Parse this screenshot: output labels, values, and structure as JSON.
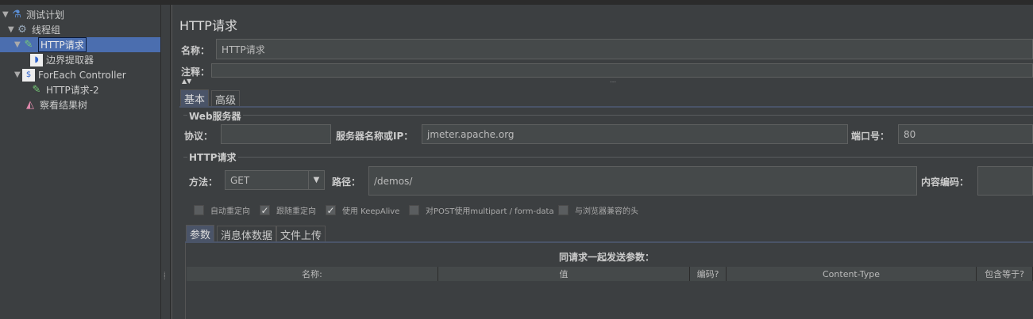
{
  "tree": [
    {
      "label": "测试计划",
      "icon": "test-plan-flask-icon"
    },
    {
      "label": "线程组",
      "icon": "thread-group-gear-icon"
    },
    {
      "label": "HTTP请求",
      "icon": "sampler-pipette-icon",
      "selected": true
    },
    {
      "label": "边界提取器",
      "icon": "extractor-icon"
    },
    {
      "label": "ForEach Controller",
      "icon": "controller-icon"
    },
    {
      "label": "HTTP请求-2",
      "icon": "sampler-pipette-icon"
    },
    {
      "label": "察看结果树",
      "icon": "listener-chart-icon"
    }
  ],
  "panel": {
    "title": "HTTP请求",
    "name_label": "名称：",
    "name_value": "HTTP请求",
    "comment_label": "注释：",
    "comment_value": "",
    "tabs": [
      "基本",
      "高级"
    ],
    "web_server": {
      "legend": "Web服务器",
      "protocol_label": "协议：",
      "protocol_value": "",
      "server_label": "服务器名称或IP：",
      "server_value": "jmeter.apache.org",
      "port_label": "端口号：",
      "port_value": "80"
    },
    "http": {
      "legend": "HTTP请求",
      "method_label": "方法：",
      "method_value": "GET",
      "path_label": "路径：",
      "path_value": "/demos/",
      "encoding_label": "内容编码：",
      "encoding_value": ""
    },
    "checkboxes": [
      {
        "label": "自动重定向",
        "checked": false
      },
      {
        "label": "跟随重定向",
        "checked": true
      },
      {
        "label": "使用 KeepAlive",
        "checked": true
      },
      {
        "label": "对POST使用multipart / form-data",
        "checked": false
      },
      {
        "label": "与浏览器兼容的头",
        "checked": false
      }
    ],
    "subtabs": [
      "参数",
      "消息体数据",
      "文件上传"
    ],
    "params_title": "同请求一起发送参数：",
    "columns": [
      "名称:",
      "值",
      "编码?",
      "Content-Type",
      "包含等于?"
    ]
  }
}
